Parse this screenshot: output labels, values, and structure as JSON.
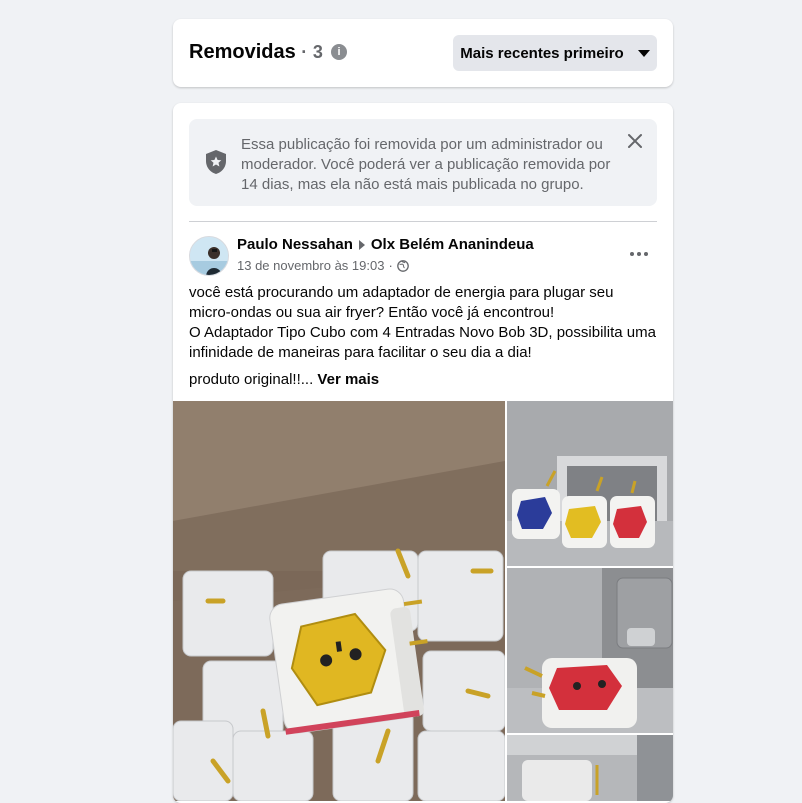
{
  "header": {
    "title": "Removidas",
    "separator": "·",
    "count": "3",
    "info_icon": "info-icon",
    "sort_label": "Mais recentes primeiro",
    "sort_icon": "caret-down-icon"
  },
  "notice": {
    "icon": "shield-star-icon",
    "text": "Essa publicação foi removida por um administrador ou moderador. Você poderá ver a publicação removida por 14 dias, mas ela não está mais publicada no grupo.",
    "close_icon": "close-icon"
  },
  "post": {
    "author": "Paulo Nessahan",
    "group": "Olx Belém Ananindeua",
    "timestamp": "13 de novembro às 19:03",
    "separator": "·",
    "privacy_icon": "globe-icon",
    "more_icon": "more-options-icon",
    "text_line1": "você está procurando um adaptador de energia para plugar seu micro-ondas ou sua air fryer? Então você já encontrou!",
    "text_line2": "O Adaptador Tipo Cubo com 4 Entradas Novo Bob 3D, possibilita uma infinidade de maneiras para facilitar o seu dia a dia!",
    "text_line3": "produto original!!...",
    "see_more": "Ver mais"
  },
  "colors": {
    "background": "#f0f2f5",
    "secondary_text": "#65676b",
    "button_bg": "#e4e6eb"
  }
}
